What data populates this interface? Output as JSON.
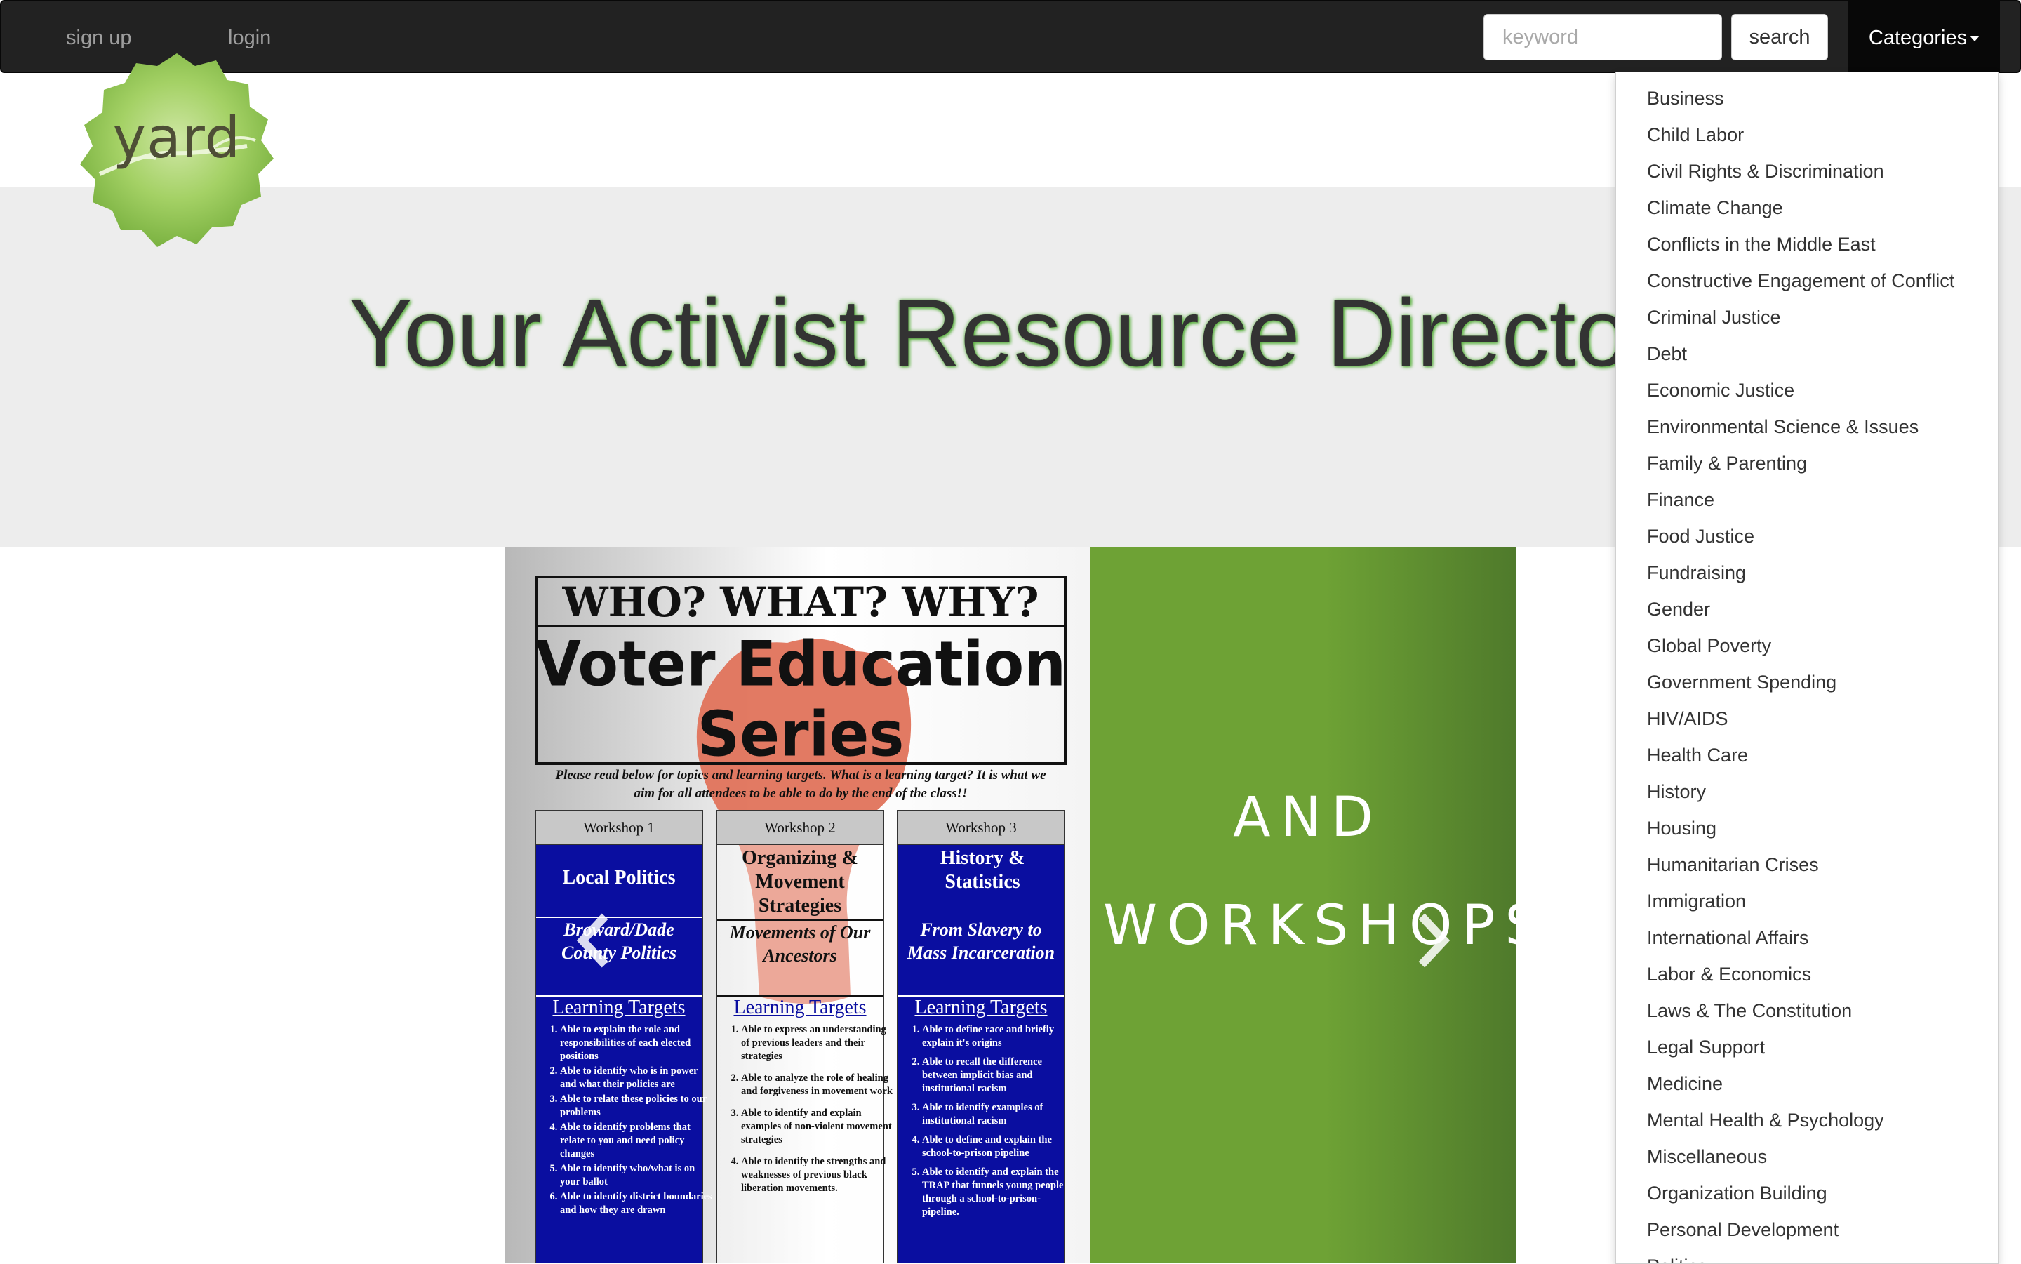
{
  "nav": {
    "signup_label": "sign up",
    "login_label": "login",
    "search_placeholder": "keyword",
    "search_button_label": "search",
    "categories_label": "Categories"
  },
  "logo": {
    "text": "yard",
    "icon": "yard-leaf-logo",
    "color": "#8cc152"
  },
  "hero": {
    "title": "Your Activist Resource Director",
    "title_glow_color": "#61b447"
  },
  "carousel": {
    "prev_icon": "chevron-left-icon",
    "next_icon": "chevron-right-icon",
    "poster": {
      "line1": "WHO? WHAT? WHY?",
      "line2a": "Voter Education",
      "line2b": "Series",
      "intro": "Please read below for topics and learning targets. What is a learning target? It is what we aim for all attendees to be able to do by the end of the class!!",
      "workshops": [
        {
          "head": "Workshop 1",
          "title": "Local Politics",
          "subtitle": "Broward/Dade County Politics",
          "lt_label": "Learning Targets",
          "targets": [
            "Able to explain the role and responsibilities of each elected positions",
            "Able to identify who is in power and what their policies are",
            "Able to relate these policies to our problems",
            "Able to identify problems that relate to you and need policy changes",
            "Able to identify who/what is on your ballot",
            "Able to identify district boundaries and how they are drawn"
          ]
        },
        {
          "head": "Workshop 2",
          "title": "Organizing & Movement Strategies",
          "subtitle": "Movements of Our Ancestors",
          "lt_label": "Learning Targets",
          "targets": [
            "Able to express an understanding of previous leaders and their strategies",
            "Able to analyze the role of healing and forgiveness in movement work",
            "Able to identify and explain examples of non-violent movement strategies",
            "Able to identify the strengths and weaknesses of previous black liberation movements."
          ]
        },
        {
          "head": "Workshop 3",
          "title": "History & Statistics",
          "subtitle": "From Slavery to Mass Incarceration",
          "lt_label": "Learning Targets",
          "targets": [
            "Able to define race and briefly explain it's origins",
            "Able to recall the difference between implicit bias and institutional racism",
            "Able to identify examples of institutional racism",
            "Able to define and explain the school-to-prison pipeline",
            "Able to identify and explain the TRAP that funnels young people through a school-to-prison-pipeline."
          ]
        }
      ]
    },
    "green_slide": {
      "line1": "AND",
      "line2": "WORKSHOPS",
      "color": "#6ea235"
    }
  },
  "categories": [
    "Business",
    "Child Labor",
    "Civil Rights & Discrimination",
    "Climate Change",
    "Conflicts in the Middle East",
    "Constructive Engagement of Conflict",
    "Criminal Justice",
    "Debt",
    "Economic Justice",
    "Environmental Science & Issues",
    "Family & Parenting",
    "Finance",
    "Food Justice",
    "Fundraising",
    "Gender",
    "Global Poverty",
    "Government Spending",
    "HIV/AIDS",
    "Health Care",
    "History",
    "Housing",
    "Humanitarian Crises",
    "Immigration",
    "International Affairs",
    "Labor & Economics",
    "Laws & The Constitution",
    "Legal Support",
    "Medicine",
    "Mental Health & Psychology",
    "Miscellaneous",
    "Organization Building",
    "Personal Development",
    "Politics"
  ]
}
